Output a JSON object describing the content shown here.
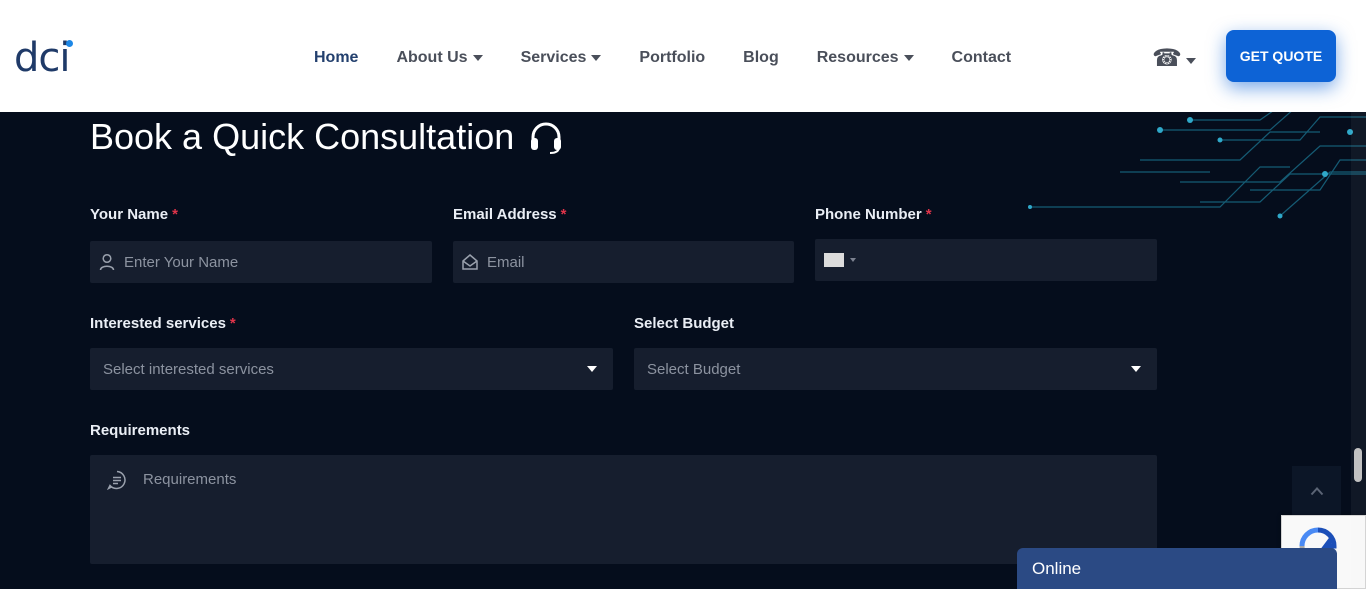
{
  "logo": {
    "text": "dci"
  },
  "nav": {
    "items": [
      {
        "label": "Home",
        "dropdown": false,
        "active": true
      },
      {
        "label": "About Us",
        "dropdown": true,
        "active": false
      },
      {
        "label": "Services",
        "dropdown": true,
        "active": false
      },
      {
        "label": "Portfolio",
        "dropdown": false,
        "active": false
      },
      {
        "label": "Blog",
        "dropdown": false,
        "active": false
      },
      {
        "label": "Resources",
        "dropdown": true,
        "active": false
      },
      {
        "label": "Contact",
        "dropdown": false,
        "active": false
      }
    ],
    "phone_icon": "☎",
    "quote_button": "GET QUOTE"
  },
  "form": {
    "title": "Book a Quick Consultation",
    "title_icon": "headset-icon",
    "required_mark": "*",
    "name": {
      "label": "Your Name",
      "placeholder": "Enter Your Name",
      "icon": "user-icon"
    },
    "email": {
      "label": "Email Address",
      "placeholder": "Email",
      "icon": "envelope-icon"
    },
    "phone": {
      "label": "Phone Number",
      "value": ""
    },
    "services": {
      "label": "Interested services",
      "placeholder": "Select interested services"
    },
    "budget": {
      "label": "Select Budget",
      "placeholder": "Select Budget"
    },
    "requirements": {
      "label": "Requirements",
      "placeholder": "Requirements",
      "icon": "message-icon"
    }
  },
  "chat": {
    "status": "Online"
  },
  "colors": {
    "background": "#050d1c",
    "field": "#161e2e",
    "accent": "#0d63d6",
    "required": "#e0344a",
    "chat": "#2b4a84"
  }
}
